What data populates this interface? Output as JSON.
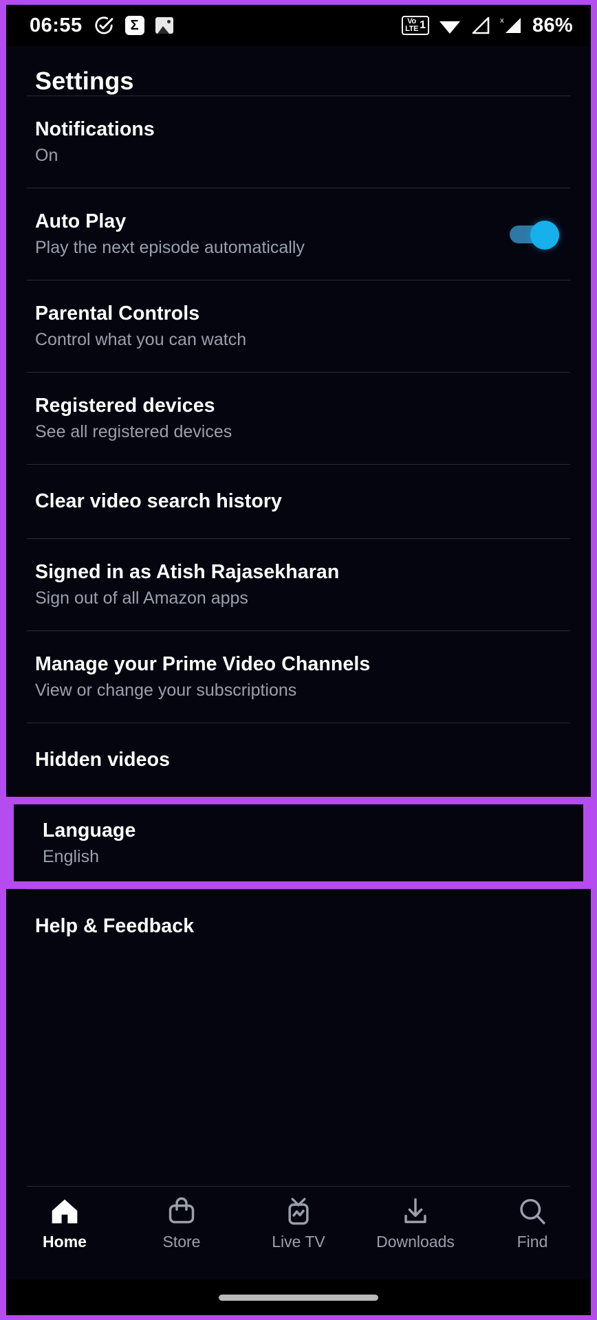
{
  "status_bar": {
    "time": "06:55",
    "battery": "86%",
    "icons": [
      {
        "name": "check-circle-icon"
      },
      {
        "name": "sigma-app-icon",
        "glyph": "Σ"
      },
      {
        "name": "image-icon"
      }
    ],
    "right_icons": [
      {
        "name": "volte-icon",
        "line1": "Vo",
        "line2": "LTE",
        "sim": "1"
      },
      {
        "name": "wifi-icon"
      },
      {
        "name": "signal-sim1-icon"
      },
      {
        "name": "signal-sim2-no-service-icon",
        "badge": "x"
      }
    ]
  },
  "header": {
    "title": "Settings"
  },
  "settings": {
    "rows": [
      {
        "title": "Notifications",
        "sub": "On",
        "has_toggle": false,
        "highlighted": false
      },
      {
        "title": "Auto Play",
        "sub": "Play the next episode automatically",
        "has_toggle": true,
        "toggle_state": "on",
        "highlighted": false
      },
      {
        "title": "Parental Controls",
        "sub": "Control what you can watch",
        "has_toggle": false,
        "highlighted": false
      },
      {
        "title": "Registered devices",
        "sub": "See all registered devices",
        "has_toggle": false,
        "highlighted": false
      },
      {
        "title": "Clear video search history",
        "sub": "",
        "has_toggle": false,
        "highlighted": false
      },
      {
        "title": "Signed in as Atish Rajasekharan",
        "sub": "Sign out of all Amazon apps",
        "has_toggle": false,
        "highlighted": false
      },
      {
        "title": "Manage your Prime Video Channels",
        "sub": "View or change your subscriptions",
        "has_toggle": false,
        "highlighted": false
      },
      {
        "title": "Hidden videos",
        "sub": "",
        "has_toggle": false,
        "highlighted": false
      },
      {
        "title": "Language",
        "sub": "English",
        "has_toggle": false,
        "highlighted": true
      },
      {
        "title": "Help & Feedback",
        "sub": "",
        "has_toggle": false,
        "highlighted": false
      }
    ]
  },
  "bottom_nav": {
    "items": [
      {
        "label": "Home",
        "icon": "home-icon",
        "active": true
      },
      {
        "label": "Store",
        "icon": "store-bag-icon",
        "active": false
      },
      {
        "label": "Live TV",
        "icon": "live-tv-icon",
        "active": false
      },
      {
        "label": "Downloads",
        "icon": "download-icon",
        "active": false
      },
      {
        "label": "Find",
        "icon": "search-icon",
        "active": false
      }
    ]
  },
  "colors": {
    "annotation": "#b44cf0",
    "background": "#050510",
    "toggle_on": "#16b0ec",
    "secondary_text": "#9aa0ab"
  }
}
